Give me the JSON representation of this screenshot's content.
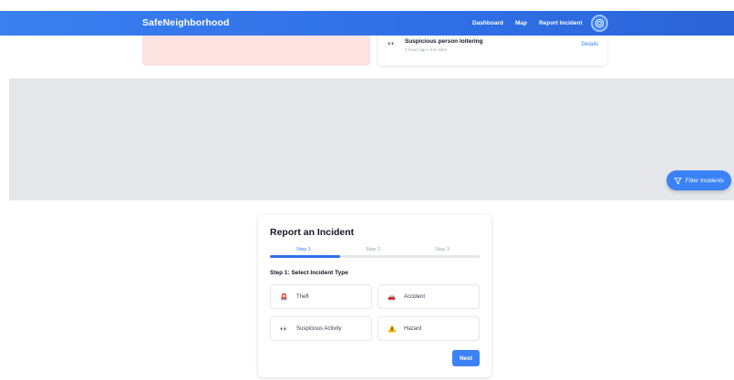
{
  "header": {
    "brand": "SafeNeighborhood",
    "nav": [
      "Dashboard",
      "Map",
      "Report Incident"
    ]
  },
  "incident": {
    "title": "Suspicious person loitering",
    "meta": "3 hours ago • 0.5 miles",
    "icon": "eyes-icon",
    "details_label": "Details"
  },
  "map": {
    "filter_label": "Filter Incidents"
  },
  "report": {
    "title": "Report an Incident",
    "steps": [
      "Step 1",
      "Step 2",
      "Step 3"
    ],
    "current_step": 1,
    "progress": 0.333,
    "step_heading": "Step 1: Select Incident Type",
    "types": [
      {
        "label": "Theft",
        "icon": "siren-icon"
      },
      {
        "label": "Accident",
        "icon": "car-icon"
      },
      {
        "label": "Suspicious Activity",
        "icon": "eyes-icon"
      },
      {
        "label": "Hazard",
        "icon": "warning-icon"
      }
    ],
    "next_label": "Next"
  },
  "colors": {
    "primary": "#3b82f6",
    "header": "#2f6fe6",
    "alert_bg": "#fde2e2",
    "map_bg": "#e5e7eb"
  }
}
